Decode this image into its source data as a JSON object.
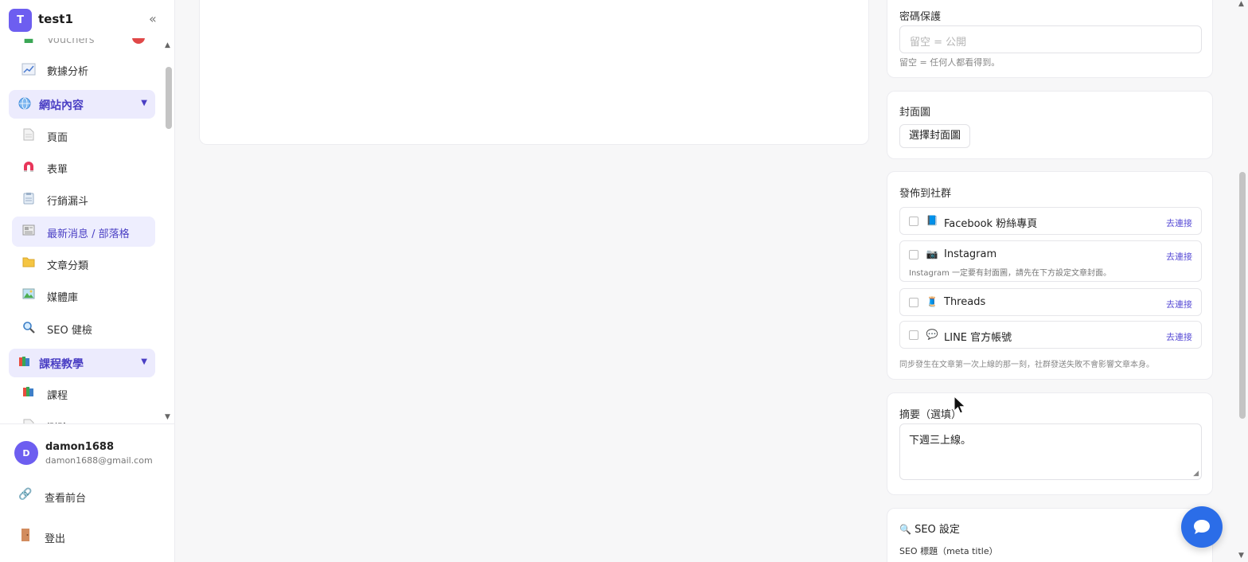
{
  "workspace": {
    "initial": "T",
    "name": "test1",
    "collapse_icon": "«"
  },
  "nav": {
    "partial_item": "Vouchers",
    "analytics": "數據分析",
    "group_site": "網站內容",
    "pages": "頁面",
    "forms": "表單",
    "funnels": "行銷漏斗",
    "news": "最新消息 / 部落格",
    "categories": "文章分類",
    "media": "媒體庫",
    "seo_check": "SEO 健檢",
    "group_course": "課程教學",
    "courses": "課程",
    "quizzes": "測驗",
    "caret": "▼"
  },
  "user": {
    "initial": "D",
    "name": "damon1688",
    "email": "damon1688@gmail.com"
  },
  "footer": {
    "view_site": "查看前台",
    "logout": "登出"
  },
  "password_panel": {
    "title": "密碼保護",
    "placeholder": "留空 = 公開",
    "hint": "留空 = 任何人都看得到。"
  },
  "cover_panel": {
    "title": "封面圖",
    "button": "選擇封面圖"
  },
  "social_panel": {
    "title": "發佈到社群",
    "connect_label": "去連接",
    "items": [
      {
        "name": "Facebook 粉絲專頁",
        "icon": "📘"
      },
      {
        "name": "Instagram",
        "icon": "📷",
        "note": "Instagram 一定要有封面圖，請先在下方設定文章封面。"
      },
      {
        "name": "Threads",
        "icon": "🧵"
      },
      {
        "name": "LINE 官方帳號",
        "icon": "💬"
      }
    ],
    "hint": "同步發生在文章第一次上線的那一刻，社群發送失敗不會影響文章本身。"
  },
  "summary_panel": {
    "title": "摘要（選填）",
    "value": "下週三上線。"
  },
  "seo_panel": {
    "title": "SEO 設定",
    "meta_title_label": "SEO 標題（meta title）"
  },
  "colors": {
    "accent": "#6d5ef0",
    "accent_text": "#4a3fc4",
    "active_bg": "#ecebfd",
    "link": "#5b4fd6",
    "chat_fab": "#2b6de8"
  }
}
